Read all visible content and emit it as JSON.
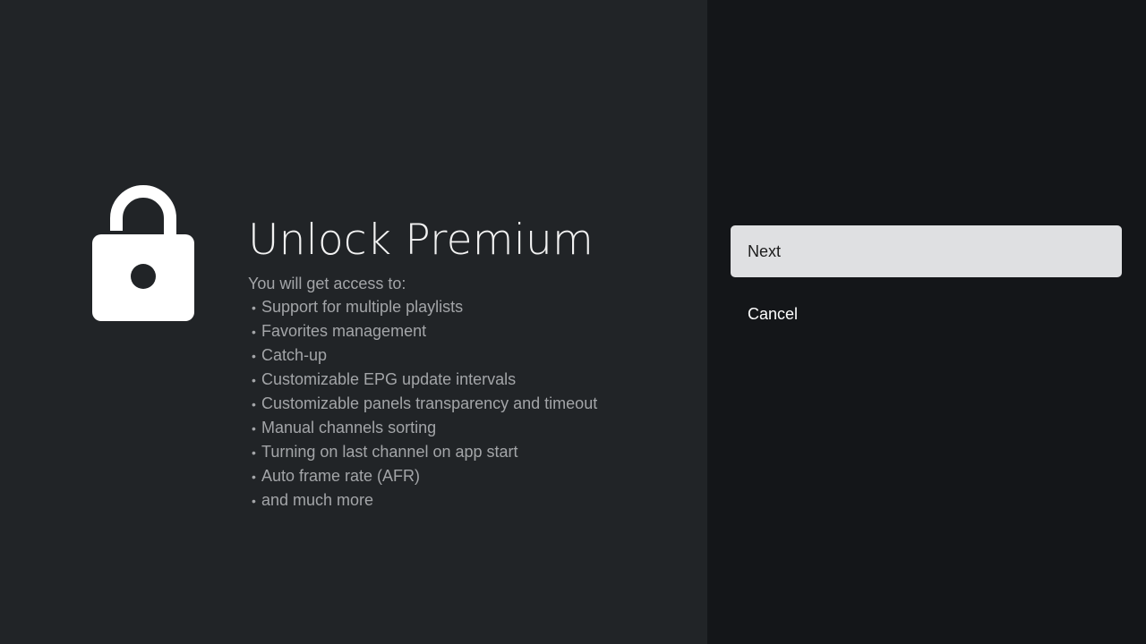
{
  "colors": {
    "left_panel_bg": "#212427",
    "right_panel_bg": "#141619",
    "focused_button_bg": "#dfe0e2",
    "title_text": "#f2f2f2",
    "body_text": "#a3a5a8"
  },
  "icon": "unlocked-padlock-icon",
  "title": "Unlock Premium",
  "intro": "You will get access to:",
  "bullet": "•",
  "features": [
    "Support for multiple playlists",
    "Favorites management",
    "Catch-up",
    "Customizable EPG update intervals",
    "Customizable panels transparency and timeout",
    "Manual channels sorting",
    "Turning on last channel on app start",
    "Auto frame rate (AFR)",
    "and much more"
  ],
  "actions": {
    "next_label": "Next",
    "cancel_label": "Cancel"
  }
}
